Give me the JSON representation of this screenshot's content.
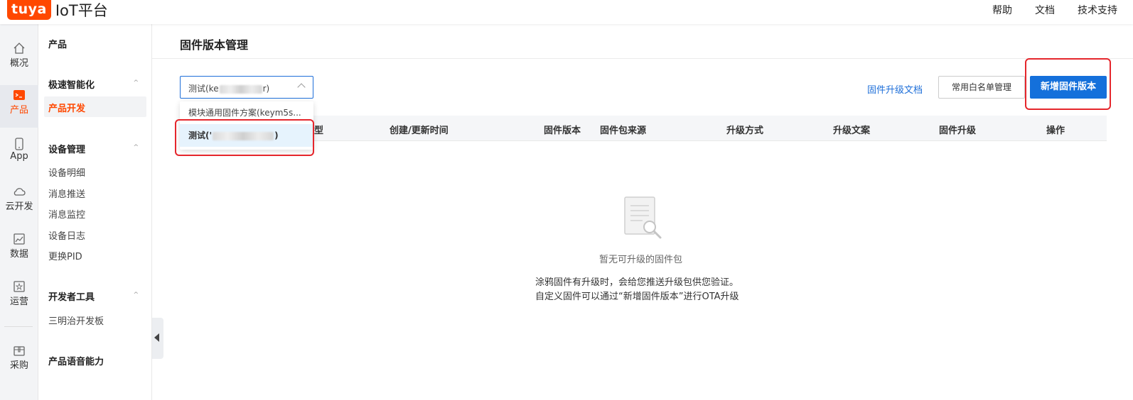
{
  "header": {
    "logo_badge": "tuya",
    "logo_text": "IoT平台",
    "links": [
      "帮助",
      "文档",
      "技术支持"
    ]
  },
  "rail": {
    "items": [
      {
        "label": "概况",
        "icon": "home-icon"
      },
      {
        "label": "产品",
        "icon": "terminal-icon",
        "active": true
      },
      {
        "label": "App",
        "icon": "phone-icon"
      },
      {
        "label": "云开发",
        "icon": "cloud-icon"
      },
      {
        "label": "数据",
        "icon": "chart-icon"
      },
      {
        "label": "运营",
        "icon": "bookmark-icon"
      },
      {
        "label": "采购",
        "icon": "box-icon"
      }
    ]
  },
  "sidenav": {
    "top_label": "产品",
    "groups": [
      {
        "title": "极速智能化",
        "items": [
          "产品开发"
        ],
        "active_item": "产品开发"
      },
      {
        "title": "设备管理",
        "items": [
          "设备明细",
          "消息推送",
          "消息监控",
          "设备日志",
          "更换PID"
        ]
      },
      {
        "title": "开发者工具",
        "items": [
          "三明治开发板"
        ]
      },
      {
        "title": "产品语音能力",
        "items": []
      }
    ]
  },
  "main": {
    "page_title": "固件版本管理",
    "select": {
      "value_prefix": "测试(ke",
      "value_suffix": "r)",
      "options": [
        {
          "label": "模块通用固件方案(keym5s...",
          "selected": false
        },
        {
          "label_prefix": "测试('",
          "label_suffix": ")",
          "selected": true
        }
      ]
    },
    "doc_link": "固件升级文档",
    "whitelist_button": "常用白名单管理",
    "add_button": "新增固件版本",
    "table": {
      "columns": [
        "型",
        "创建/更新时间",
        "固件版本",
        "固件包来源",
        "升级方式",
        "升级文案",
        "固件升级",
        "操作"
      ]
    },
    "empty": {
      "title": "暂无可升级的固件包",
      "line1": "涂鸦固件有升级时，会给您推送升级包供您验证。",
      "line2": "自定义固件可以通过“新增固件版本”进行OTA升级"
    }
  },
  "colors": {
    "brand": "#ff4800",
    "primary": "#1470db",
    "highlight": "#e5262c"
  }
}
